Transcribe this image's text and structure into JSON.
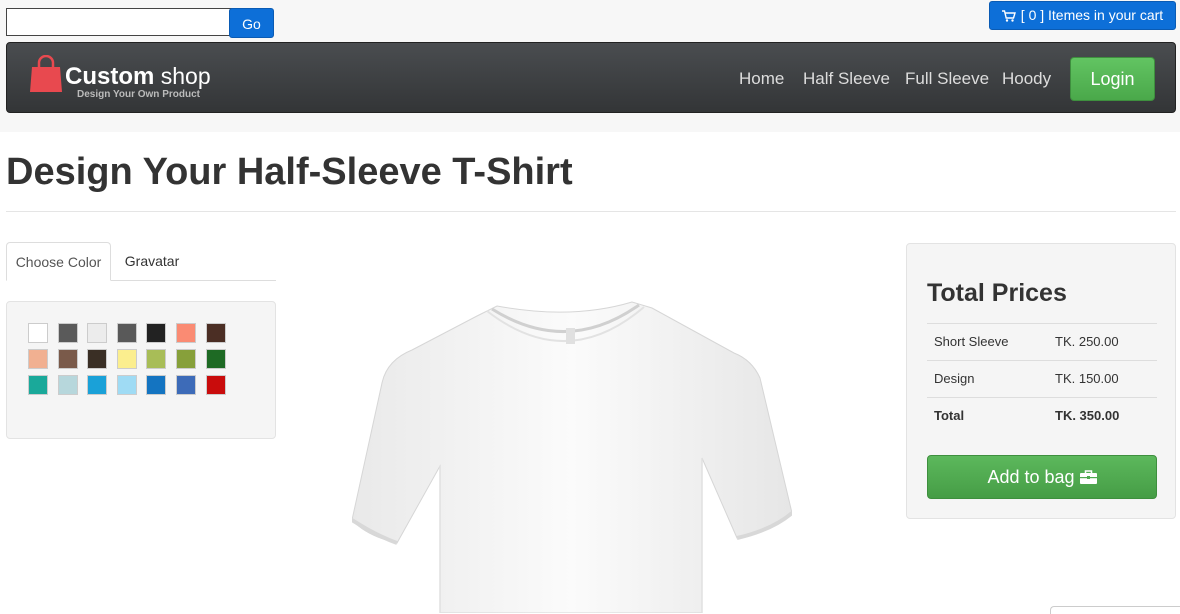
{
  "search": {
    "value": "",
    "placeholder": "",
    "go_label": "Go"
  },
  "cart": {
    "label": "[ 0 ] Itemes in your cart",
    "icon": "cart-icon"
  },
  "brand": {
    "name_bold": "Custom",
    "name_light": " shop",
    "tagline": "Design Your Own Product",
    "icon": "shopping-bag-icon",
    "color": "#e8494f"
  },
  "nav": {
    "items": [
      "Home",
      "Half Sleeve",
      "Full Sleeve",
      "Hoody"
    ],
    "login_label": "Login"
  },
  "page": {
    "title": "Design Your Half-Sleeve T-Shirt"
  },
  "tabs": [
    {
      "label": "Choose Color",
      "active": true
    },
    {
      "label": "Gravatar",
      "active": false
    }
  ],
  "swatches": [
    "#ffffff",
    "#5a5a5a",
    "#ececec",
    "#595959",
    "#222222",
    "#fa8b73",
    "#4b2e24",
    "#f1b091",
    "#7a5a4a",
    "#3a2f25",
    "#fbee8e",
    "#a8bd57",
    "#87a03a",
    "#1e6a24",
    "#1aa99a",
    "#b7d7dc",
    "#1aa1d8",
    "#9fdbf4",
    "#1474c1",
    "#3d6bb8",
    "#c90c0c"
  ],
  "prices": {
    "title": "Total Prices",
    "rows": [
      {
        "label": "Short Sleeve",
        "value": "TK. 250.00"
      },
      {
        "label": "Design",
        "value": "TK. 150.00"
      },
      {
        "label": "Total",
        "value": "TK. 350.00"
      }
    ],
    "add_label": "Add to bag",
    "add_icon": "briefcase-icon"
  },
  "colors": {
    "primary": "#0d6fd8",
    "success": "#5cb85c",
    "navbar": "#3e4144"
  }
}
